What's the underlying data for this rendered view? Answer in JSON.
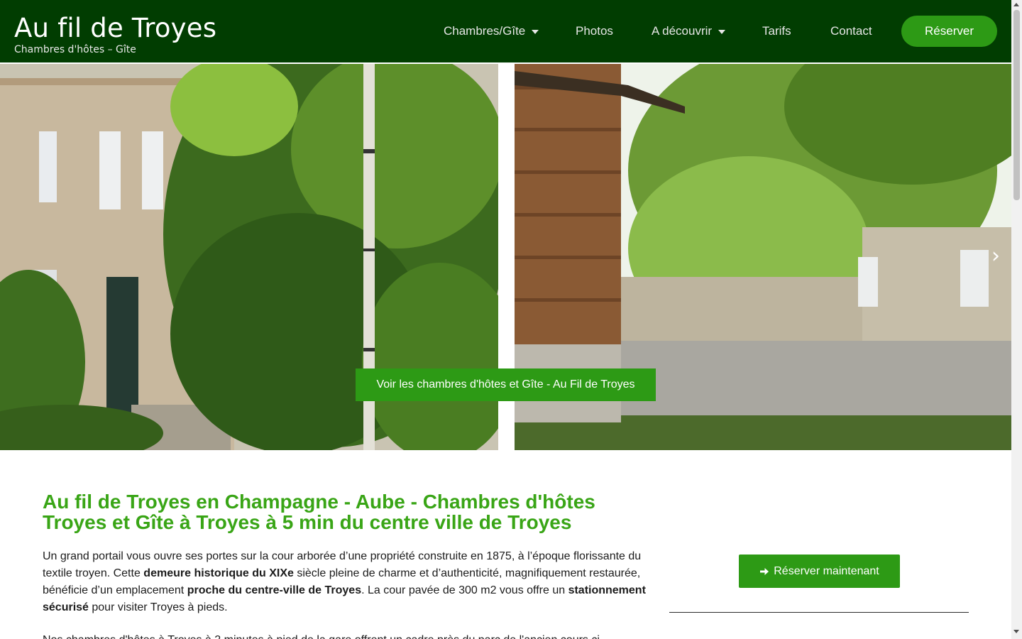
{
  "header": {
    "brand_title": "Au fil de Troyes",
    "brand_subtitle": "Chambres d'hôtes – Gîte",
    "nav": [
      {
        "label": "Chambres/Gîte",
        "has_dropdown": true
      },
      {
        "label": "Photos",
        "has_dropdown": false
      },
      {
        "label": "A découvrir",
        "has_dropdown": true
      },
      {
        "label": "Tarifs",
        "has_dropdown": false
      },
      {
        "label": "Contact",
        "has_dropdown": false
      }
    ],
    "reserve_label": "Réserver",
    "bg_color": "#013d01",
    "accent_color": "#2d9a15"
  },
  "hero": {
    "cta_label": "Voir les chambres d'hôtes et Gîte - Au Fil de Troyes",
    "next_arrow": "›",
    "icons": [
      "chevron-right-icon"
    ]
  },
  "main": {
    "title": "Au fil de Troyes en Champagne - Aube - Chambres d'hôtes Troyes et Gîte à Troyes à 5 min du centre ville de Troyes",
    "title_color": "#39a516",
    "paragraph1": {
      "t1": "Un grand portail vous ouvre ses portes sur la cour arborée d’une propriété construite en 1875, à l’époque florissante du textile troyen. Cette ",
      "b1": "demeure historique du XIXe",
      "t2": " siècle pleine de charme et d’authenticité, magnifiquement restaurée, bénéficie d’un emplacement ",
      "b2": "proche du centre-ville de Troyes",
      "t3": ". La cour pavée de 300 m2 vous offre un ",
      "b3": "stationnement sécurisé",
      "t4": " pour visiter Troyes à pieds."
    },
    "paragraph2_partial": "Nos chambres d'hôtes à Troyes à 2 minutes à pied de la gare offrent un cadre près du parc de l'ancien cours ci..."
  },
  "sidebar": {
    "reserve_now_label": "Réserver maintenant",
    "icons": [
      "arrow-right-icon"
    ]
  }
}
